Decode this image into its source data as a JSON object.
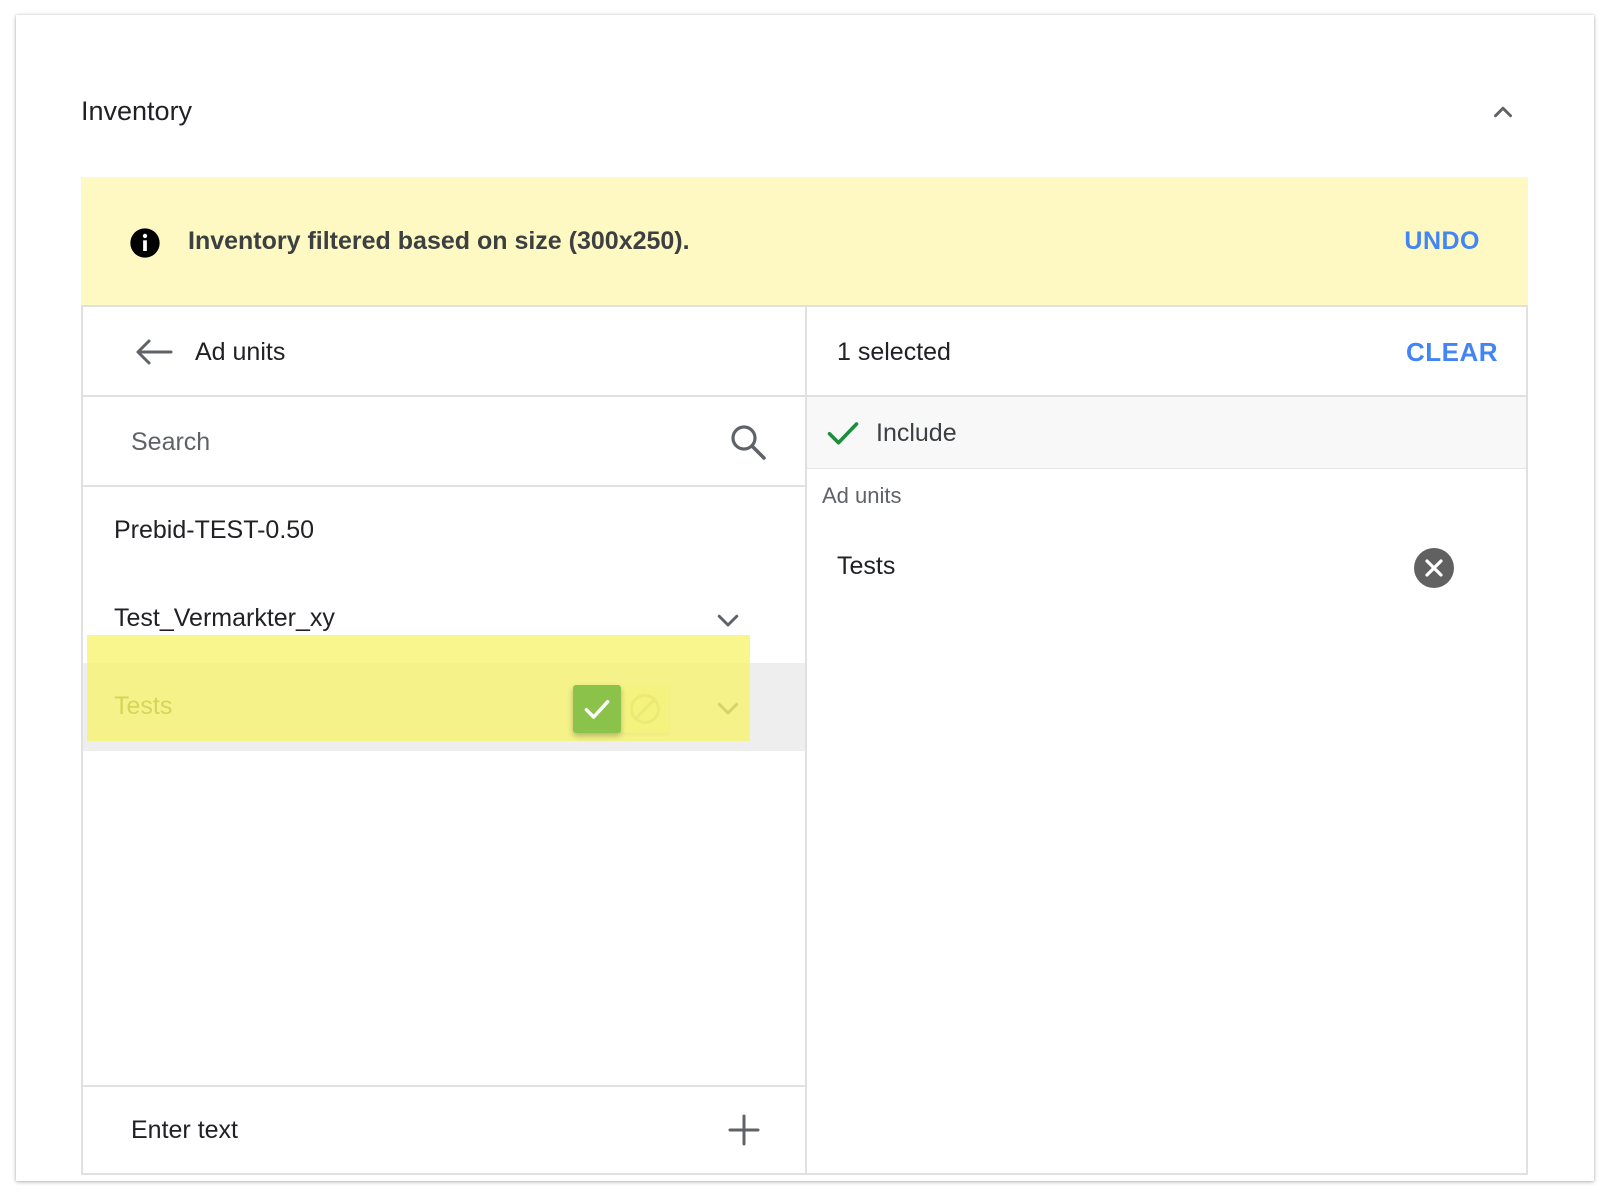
{
  "section": {
    "title": "Inventory",
    "collapse_icon": "chevron-up-icon"
  },
  "banner": {
    "message": "Inventory filtered based on size (300x250).",
    "undo_label": "UNDO",
    "icon": "info-icon"
  },
  "left_panel": {
    "header_title": "Ad units",
    "back_icon": "arrow-left-icon",
    "search": {
      "placeholder": "Search",
      "value": ""
    },
    "items": [
      {
        "label": "Prebid-TEST-0.50",
        "expandable": false
      },
      {
        "label": "Test_Vermarkter_xy",
        "expandable": true
      },
      {
        "label": "Tests",
        "expandable": true,
        "hovered": true,
        "included": true
      }
    ],
    "footer": {
      "placeholder": "Enter text",
      "add_icon": "plus-icon"
    }
  },
  "right_panel": {
    "count_label": "1 selected",
    "clear_label": "CLEAR",
    "include_label": "Include",
    "group_label": "Ad units",
    "selected_items": [
      {
        "label": "Tests"
      }
    ]
  },
  "colors": {
    "accent": "#4285f4",
    "banner_bg": "#fef9c2",
    "include_green": "#8bc34a",
    "check_green": "#1e8e3e",
    "highlight": "#f6f46c"
  }
}
